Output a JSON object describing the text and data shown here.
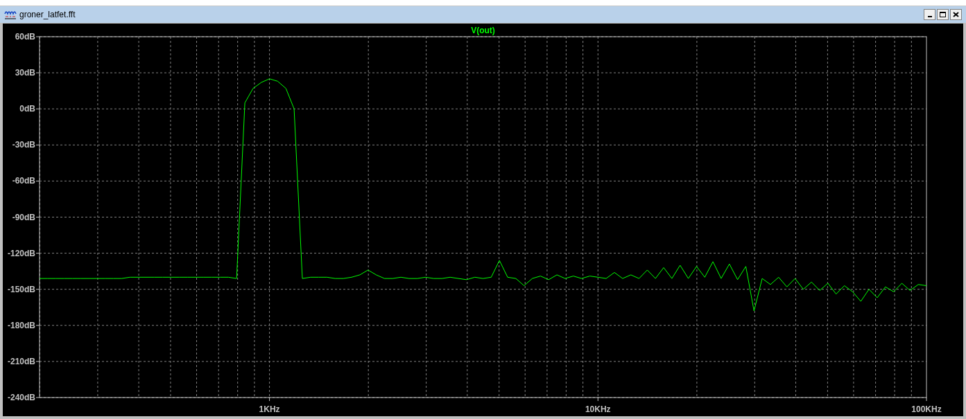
{
  "window": {
    "title": "groner_latfet.fft"
  },
  "chart_data": {
    "type": "line",
    "categories": [
      null,
      null,
      null,
      null,
      null,
      null,
      null,
      null,
      null,
      null,
      null,
      null,
      null,
      null,
      null,
      null,
      null,
      null,
      null,
      null,
      null,
      null,
      null,
      null,
      null,
      null,
      null,
      null,
      "1KHz",
      null,
      null,
      null,
      null,
      null,
      null,
      null,
      null,
      null,
      null,
      null,
      null,
      null,
      null,
      null,
      null,
      null,
      null,
      null,
      null,
      null,
      null,
      null,
      null,
      null,
      null,
      null,
      null,
      null,
      null,
      null,
      null,
      null,
      null,
      null,
      null,
      null,
      null,
      null,
      "10KHz",
      null,
      null,
      null,
      null,
      null,
      null,
      null,
      null,
      null,
      null,
      null,
      null,
      null,
      null,
      null,
      null,
      null,
      null,
      null,
      null,
      null,
      null,
      null,
      null,
      null,
      null,
      null,
      null,
      null,
      null,
      null,
      null,
      null,
      null,
      null,
      null,
      null,
      null,
      null,
      "100KHz"
    ],
    "series": [
      {
        "name": "V(out)",
        "color": "#00ff00",
        "values": [
          -141,
          -141,
          -141,
          -141,
          -141,
          -141,
          -141,
          -141,
          -141,
          -141,
          -141,
          -140,
          -140,
          -140,
          -140,
          -140,
          -140,
          -140,
          -140,
          -140,
          -140,
          -140,
          -140,
          -140,
          -141,
          5,
          17,
          22,
          25,
          23,
          17,
          0,
          -141,
          -140,
          -140,
          -140,
          -141,
          -141,
          -140,
          -138,
          -134,
          -138,
          -141,
          -141,
          -140,
          -141,
          -141,
          -140,
          -141,
          -141,
          -140,
          -141,
          -142,
          -140,
          -141,
          -140,
          -126,
          -140,
          -141,
          -147,
          -141,
          -139,
          -142,
          -138,
          -141,
          -139,
          -141,
          -139,
          -140,
          -141,
          -136,
          -141,
          -138,
          -141,
          -134,
          -141,
          -132,
          -141,
          -130,
          -141,
          -131,
          -140,
          -127,
          -141,
          -129,
          -142,
          -131,
          -168,
          -141,
          -146,
          -140,
          -148,
          -141,
          -150,
          -144,
          -151,
          -145,
          -154,
          -147,
          -152,
          -160,
          -150,
          -157,
          -148,
          -152,
          -145,
          -151,
          -146,
          -147
        ]
      }
    ],
    "ylim": [
      -240,
      60
    ],
    "grid": true,
    "yticks": [
      {
        "value": 60,
        "label": "60dB"
      },
      {
        "value": 30,
        "label": "30dB"
      },
      {
        "value": 0,
        "label": "0dB"
      },
      {
        "value": -30,
        "label": "-30dB"
      },
      {
        "value": -60,
        "label": "-60dB"
      },
      {
        "value": -90,
        "label": "-90dB"
      },
      {
        "value": -120,
        "label": "-120dB"
      },
      {
        "value": -150,
        "label": "-150dB"
      },
      {
        "value": -180,
        "label": "-180dB"
      },
      {
        "value": -210,
        "label": "-210dB"
      },
      {
        "value": -240,
        "label": "-240dB"
      }
    ]
  }
}
